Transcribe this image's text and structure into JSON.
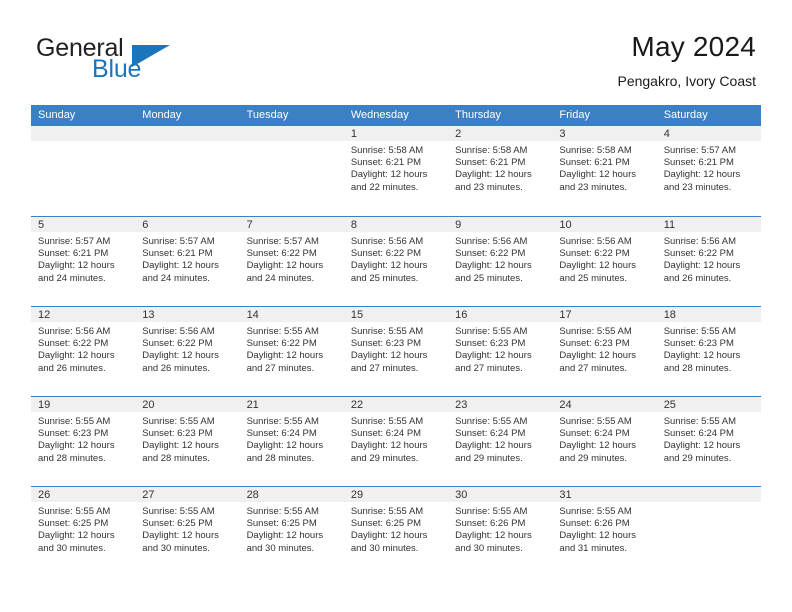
{
  "brand": {
    "name_part1": "General",
    "name_part2": "Blue",
    "accent_color": "#1b75bc",
    "logo_icon": "triangle-icon"
  },
  "header": {
    "title": "May 2024",
    "subtitle": "Pengakro, Ivory Coast"
  },
  "colors": {
    "header_row_bg": "#3b7fc4",
    "day_band_bg": "#f0f0f0",
    "text": "#333333",
    "grid_line": "#3b7fc4"
  },
  "weekdays": [
    "Sunday",
    "Monday",
    "Tuesday",
    "Wednesday",
    "Thursday",
    "Friday",
    "Saturday"
  ],
  "weeks": [
    [
      {
        "day": "",
        "lines": []
      },
      {
        "day": "",
        "lines": []
      },
      {
        "day": "",
        "lines": []
      },
      {
        "day": "1",
        "lines": [
          "Sunrise: 5:58 AM",
          "Sunset: 6:21 PM",
          "Daylight: 12 hours",
          "and 22 minutes."
        ]
      },
      {
        "day": "2",
        "lines": [
          "Sunrise: 5:58 AM",
          "Sunset: 6:21 PM",
          "Daylight: 12 hours",
          "and 23 minutes."
        ]
      },
      {
        "day": "3",
        "lines": [
          "Sunrise: 5:58 AM",
          "Sunset: 6:21 PM",
          "Daylight: 12 hours",
          "and 23 minutes."
        ]
      },
      {
        "day": "4",
        "lines": [
          "Sunrise: 5:57 AM",
          "Sunset: 6:21 PM",
          "Daylight: 12 hours",
          "and 23 minutes."
        ]
      }
    ],
    [
      {
        "day": "5",
        "lines": [
          "Sunrise: 5:57 AM",
          "Sunset: 6:21 PM",
          "Daylight: 12 hours",
          "and 24 minutes."
        ]
      },
      {
        "day": "6",
        "lines": [
          "Sunrise: 5:57 AM",
          "Sunset: 6:21 PM",
          "Daylight: 12 hours",
          "and 24 minutes."
        ]
      },
      {
        "day": "7",
        "lines": [
          "Sunrise: 5:57 AM",
          "Sunset: 6:22 PM",
          "Daylight: 12 hours",
          "and 24 minutes."
        ]
      },
      {
        "day": "8",
        "lines": [
          "Sunrise: 5:56 AM",
          "Sunset: 6:22 PM",
          "Daylight: 12 hours",
          "and 25 minutes."
        ]
      },
      {
        "day": "9",
        "lines": [
          "Sunrise: 5:56 AM",
          "Sunset: 6:22 PM",
          "Daylight: 12 hours",
          "and 25 minutes."
        ]
      },
      {
        "day": "10",
        "lines": [
          "Sunrise: 5:56 AM",
          "Sunset: 6:22 PM",
          "Daylight: 12 hours",
          "and 25 minutes."
        ]
      },
      {
        "day": "11",
        "lines": [
          "Sunrise: 5:56 AM",
          "Sunset: 6:22 PM",
          "Daylight: 12 hours",
          "and 26 minutes."
        ]
      }
    ],
    [
      {
        "day": "12",
        "lines": [
          "Sunrise: 5:56 AM",
          "Sunset: 6:22 PM",
          "Daylight: 12 hours",
          "and 26 minutes."
        ]
      },
      {
        "day": "13",
        "lines": [
          "Sunrise: 5:56 AM",
          "Sunset: 6:22 PM",
          "Daylight: 12 hours",
          "and 26 minutes."
        ]
      },
      {
        "day": "14",
        "lines": [
          "Sunrise: 5:55 AM",
          "Sunset: 6:22 PM",
          "Daylight: 12 hours",
          "and 27 minutes."
        ]
      },
      {
        "day": "15",
        "lines": [
          "Sunrise: 5:55 AM",
          "Sunset: 6:23 PM",
          "Daylight: 12 hours",
          "and 27 minutes."
        ]
      },
      {
        "day": "16",
        "lines": [
          "Sunrise: 5:55 AM",
          "Sunset: 6:23 PM",
          "Daylight: 12 hours",
          "and 27 minutes."
        ]
      },
      {
        "day": "17",
        "lines": [
          "Sunrise: 5:55 AM",
          "Sunset: 6:23 PM",
          "Daylight: 12 hours",
          "and 27 minutes."
        ]
      },
      {
        "day": "18",
        "lines": [
          "Sunrise: 5:55 AM",
          "Sunset: 6:23 PM",
          "Daylight: 12 hours",
          "and 28 minutes."
        ]
      }
    ],
    [
      {
        "day": "19",
        "lines": [
          "Sunrise: 5:55 AM",
          "Sunset: 6:23 PM",
          "Daylight: 12 hours",
          "and 28 minutes."
        ]
      },
      {
        "day": "20",
        "lines": [
          "Sunrise: 5:55 AM",
          "Sunset: 6:23 PM",
          "Daylight: 12 hours",
          "and 28 minutes."
        ]
      },
      {
        "day": "21",
        "lines": [
          "Sunrise: 5:55 AM",
          "Sunset: 6:24 PM",
          "Daylight: 12 hours",
          "and 28 minutes."
        ]
      },
      {
        "day": "22",
        "lines": [
          "Sunrise: 5:55 AM",
          "Sunset: 6:24 PM",
          "Daylight: 12 hours",
          "and 29 minutes."
        ]
      },
      {
        "day": "23",
        "lines": [
          "Sunrise: 5:55 AM",
          "Sunset: 6:24 PM",
          "Daylight: 12 hours",
          "and 29 minutes."
        ]
      },
      {
        "day": "24",
        "lines": [
          "Sunrise: 5:55 AM",
          "Sunset: 6:24 PM",
          "Daylight: 12 hours",
          "and 29 minutes."
        ]
      },
      {
        "day": "25",
        "lines": [
          "Sunrise: 5:55 AM",
          "Sunset: 6:24 PM",
          "Daylight: 12 hours",
          "and 29 minutes."
        ]
      }
    ],
    [
      {
        "day": "26",
        "lines": [
          "Sunrise: 5:55 AM",
          "Sunset: 6:25 PM",
          "Daylight: 12 hours",
          "and 30 minutes."
        ]
      },
      {
        "day": "27",
        "lines": [
          "Sunrise: 5:55 AM",
          "Sunset: 6:25 PM",
          "Daylight: 12 hours",
          "and 30 minutes."
        ]
      },
      {
        "day": "28",
        "lines": [
          "Sunrise: 5:55 AM",
          "Sunset: 6:25 PM",
          "Daylight: 12 hours",
          "and 30 minutes."
        ]
      },
      {
        "day": "29",
        "lines": [
          "Sunrise: 5:55 AM",
          "Sunset: 6:25 PM",
          "Daylight: 12 hours",
          "and 30 minutes."
        ]
      },
      {
        "day": "30",
        "lines": [
          "Sunrise: 5:55 AM",
          "Sunset: 6:26 PM",
          "Daylight: 12 hours",
          "and 30 minutes."
        ]
      },
      {
        "day": "31",
        "lines": [
          "Sunrise: 5:55 AM",
          "Sunset: 6:26 PM",
          "Daylight: 12 hours",
          "and 31 minutes."
        ]
      },
      {
        "day": "",
        "lines": []
      }
    ]
  ]
}
